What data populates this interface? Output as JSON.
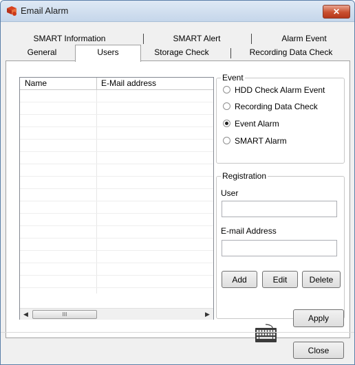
{
  "window": {
    "title": "Email Alarm",
    "close_glyph": "✕",
    "icon": "email-alarm-app-icon"
  },
  "tabs": {
    "row_back": [
      "SMART Information",
      "SMART Alert",
      "Alarm Event"
    ],
    "row_front": [
      "General",
      "Users",
      "Storage Check",
      "Recording Data Check"
    ],
    "active": "Users"
  },
  "user_list": {
    "columns": [
      "Name",
      "E-Mail address"
    ],
    "rows": [],
    "scroll_left_glyph": "◀",
    "scroll_right_glyph": "▶",
    "scroll_thumb_glyph": "III"
  },
  "event_group": {
    "title": "Event",
    "options": [
      {
        "label": "HDD Check Alarm Event",
        "selected": false
      },
      {
        "label": "Recording Data Check",
        "selected": false
      },
      {
        "label": "Event Alarm",
        "selected": true
      },
      {
        "label": "SMART Alarm",
        "selected": false
      }
    ]
  },
  "registration": {
    "title": "Registration",
    "user_label": "User",
    "user_value": "",
    "email_label": "E-mail Address",
    "email_value": "",
    "add_label": "Add",
    "edit_label": "Edit",
    "delete_label": "Delete"
  },
  "footer": {
    "keyboard_icon": "keyboard-icon",
    "apply_label": "Apply",
    "close_label": "Close"
  },
  "colors": {
    "title_gradient_top": "#dfe9f5",
    "close_button": "#c9502f",
    "app_icon": "#cc3a1a"
  }
}
